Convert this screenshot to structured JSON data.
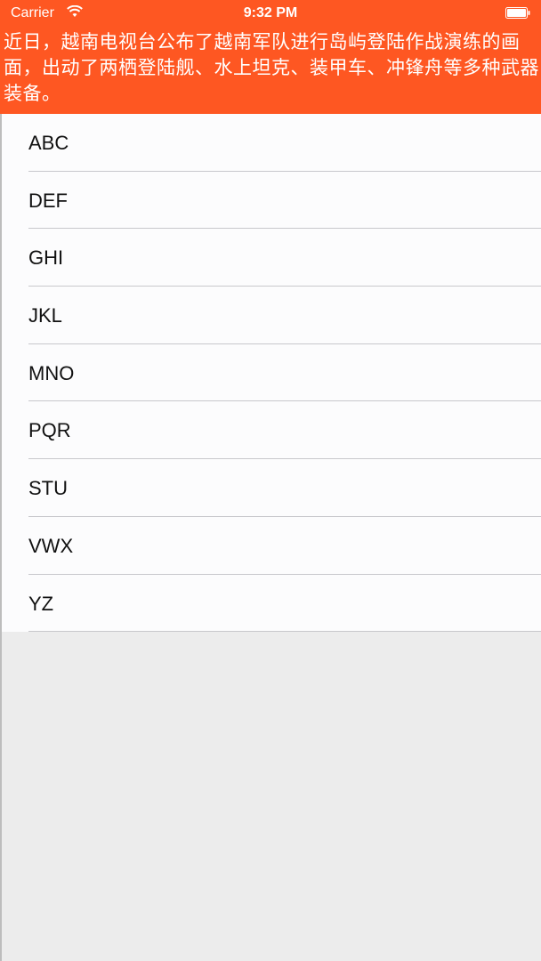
{
  "status_bar": {
    "carrier": "Carrier",
    "time": "9:32 PM",
    "wifi_icon": "wifi-icon",
    "battery_icon": "battery-icon"
  },
  "header": {
    "background_color": "#fe5722",
    "headline": "近日，越南电视台公布了越南军队进行岛屿登陆作战演练的画面，出动了两栖登陆舰、水上坦克、装甲车、冲锋舟等多种武器装备。"
  },
  "list": {
    "items": [
      {
        "label": "ABC"
      },
      {
        "label": "DEF"
      },
      {
        "label": "GHI"
      },
      {
        "label": "JKL"
      },
      {
        "label": "MNO"
      },
      {
        "label": "PQR"
      },
      {
        "label": "STU"
      },
      {
        "label": "VWX"
      },
      {
        "label": "YZ"
      }
    ]
  }
}
